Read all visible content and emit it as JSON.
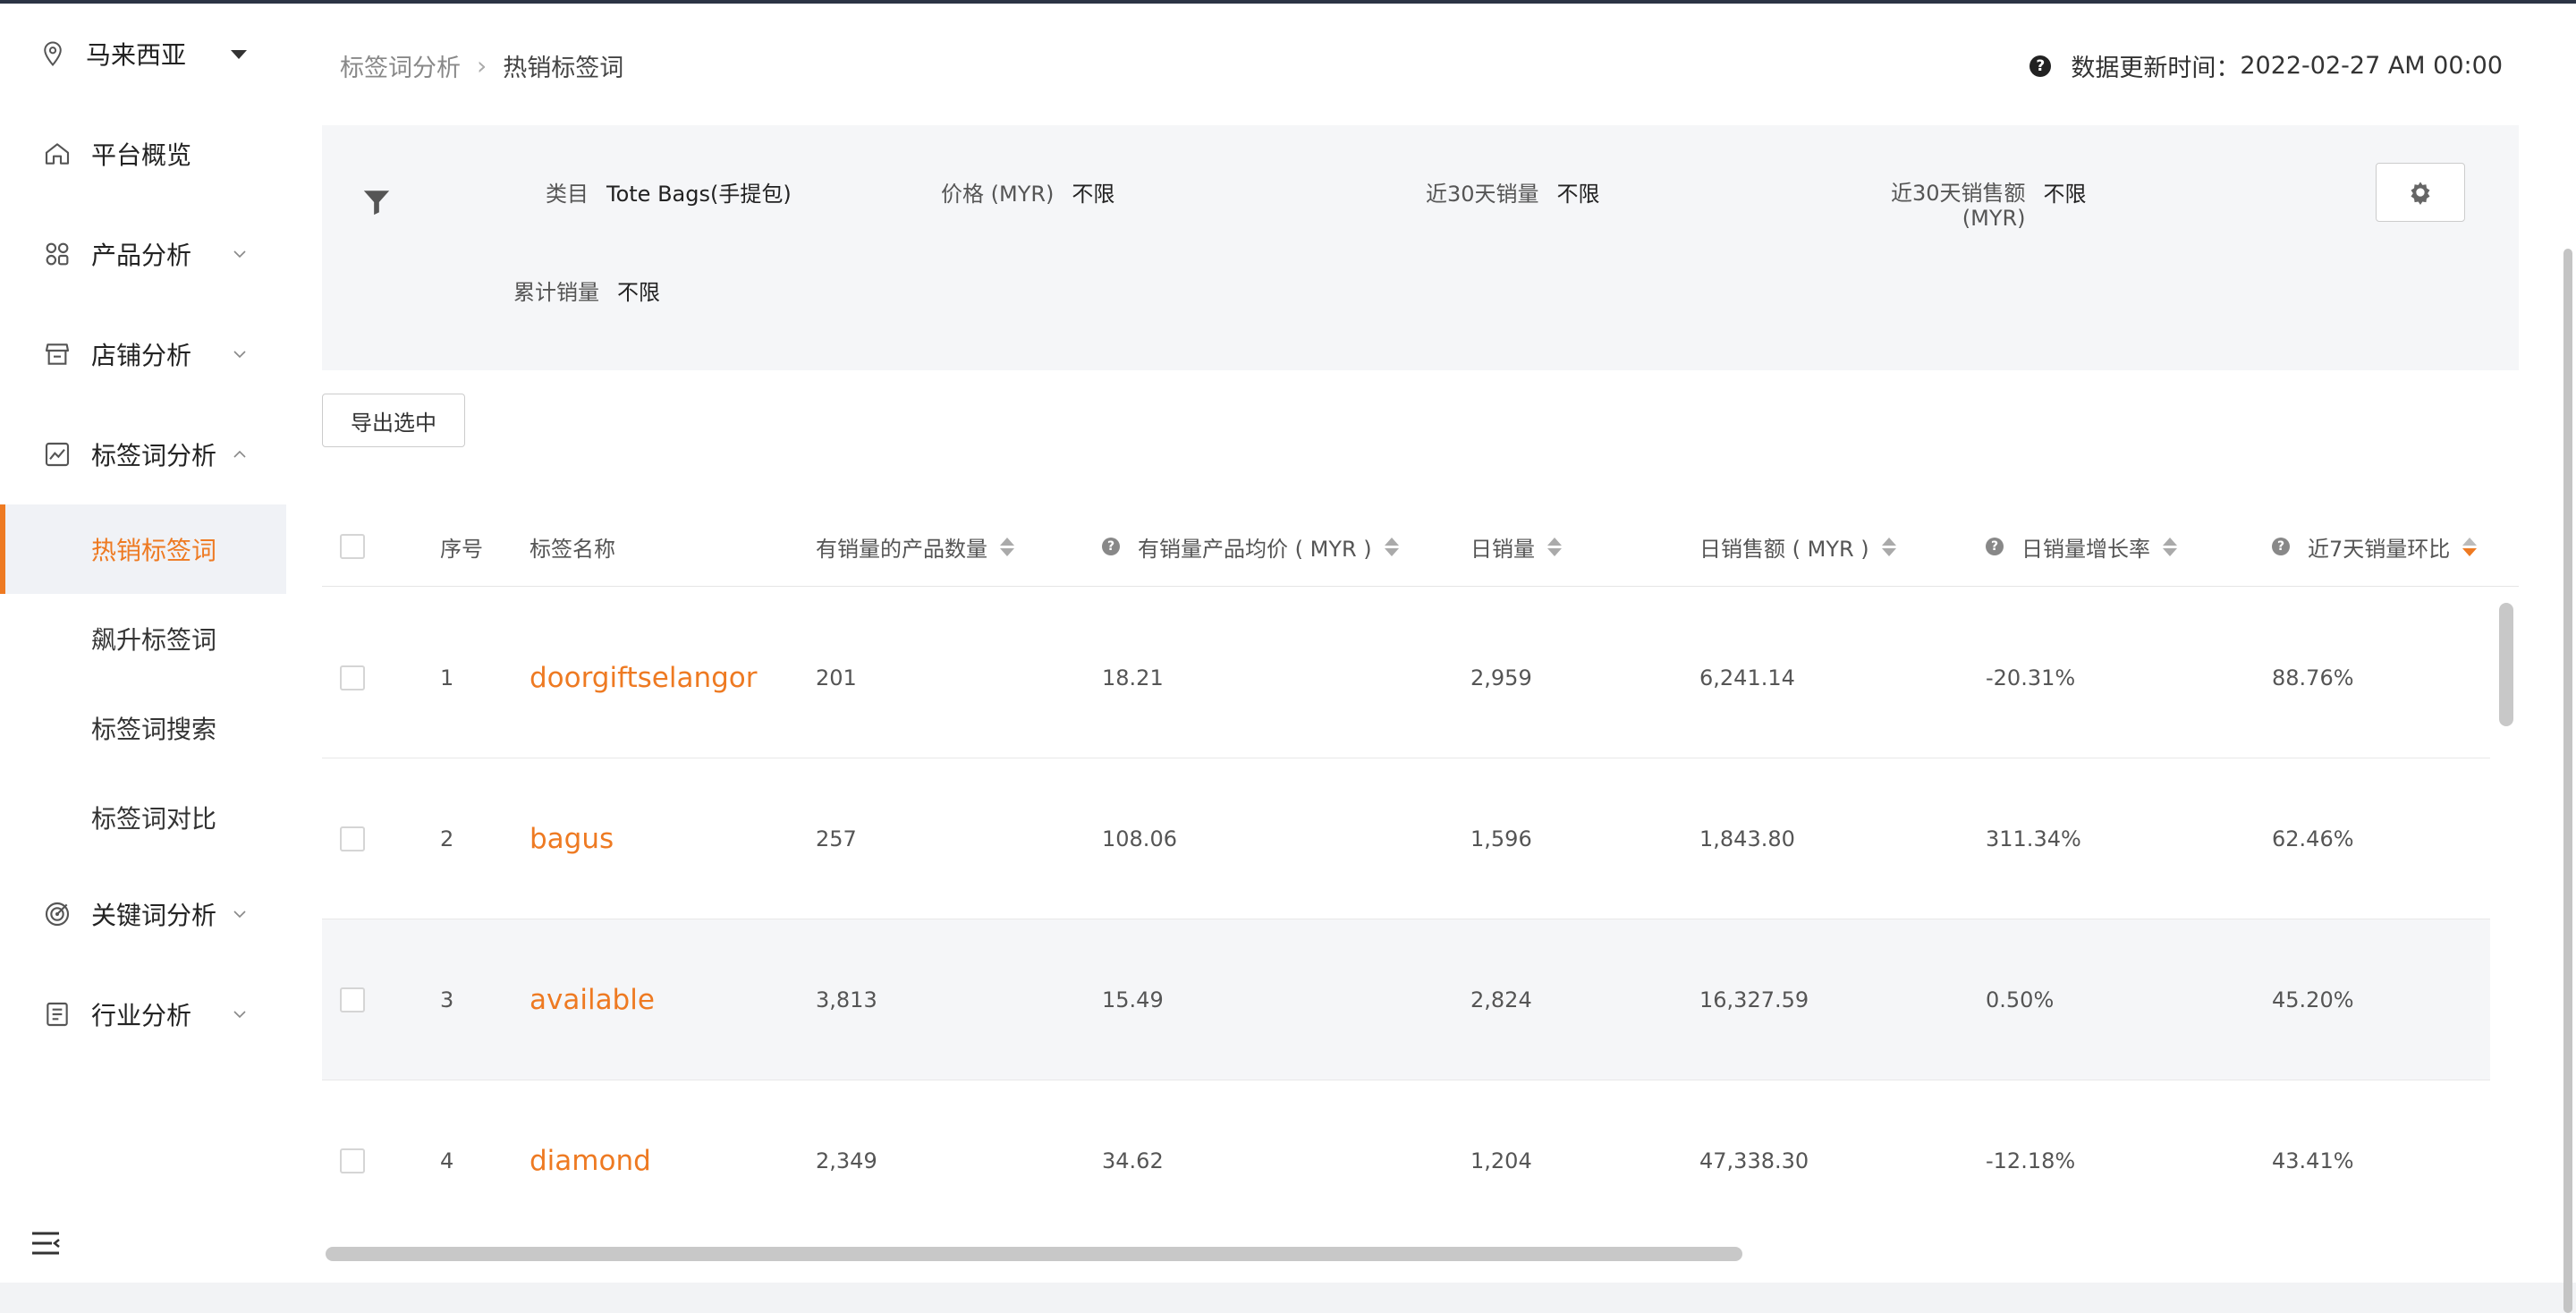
{
  "sidebar": {
    "region": "马来西亚",
    "items": [
      {
        "label": "平台概览",
        "icon": "home-icon",
        "expandable": false
      },
      {
        "label": "产品分析",
        "icon": "grid-icon",
        "expandable": true
      },
      {
        "label": "店铺分析",
        "icon": "store-icon",
        "expandable": true
      },
      {
        "label": "标签词分析",
        "icon": "chart-icon",
        "expandable": true,
        "expanded": true
      },
      {
        "label": "关键词分析",
        "icon": "target-icon",
        "expandable": true
      },
      {
        "label": "行业分析",
        "icon": "document-icon",
        "expandable": true
      }
    ],
    "sub_items": [
      {
        "label": "热销标签词",
        "active": true
      },
      {
        "label": "飙升标签词"
      },
      {
        "label": "标签词搜索"
      },
      {
        "label": "标签词对比"
      }
    ]
  },
  "header": {
    "breadcrumb": [
      "标签词分析",
      "热销标签词"
    ],
    "update_label": "数据更新时间：",
    "update_time": "2022-02-27 AM 00:00"
  },
  "filters": {
    "category_label": "类目",
    "category_value": "Tote Bags(手提包)",
    "price_label": "价格 (MYR)",
    "price_value": "不限",
    "sales30_label": "近30天销量",
    "sales30_value": "不限",
    "revenue30_label_1": "近30天销售额",
    "revenue30_label_2": "(MYR)",
    "revenue30_value": "不限",
    "total_label": "累计销量",
    "total_value": "不限"
  },
  "actions": {
    "export": "导出选中"
  },
  "table": {
    "columns": [
      "序号",
      "标签名称",
      "有销量的产品数量",
      "有销量产品均价 ( MYR )",
      "日销量",
      "日销售额 ( MYR )",
      "日销量增长率",
      "近7天销量环比"
    ],
    "rows": [
      {
        "index": "1",
        "name": "doorgiftselangor",
        "products": "201",
        "avg_price": "18.21",
        "daily_sales": "2,959",
        "daily_revenue": "6,241.14",
        "growth": "-20.31%",
        "wow": "88.76%"
      },
      {
        "index": "2",
        "name": "bagus",
        "products": "257",
        "avg_price": "108.06",
        "daily_sales": "1,596",
        "daily_revenue": "1,843.80",
        "growth": "311.34%",
        "wow": "62.46%"
      },
      {
        "index": "3",
        "name": "available",
        "products": "3,813",
        "avg_price": "15.49",
        "daily_sales": "2,824",
        "daily_revenue": "16,327.59",
        "growth": "0.50%",
        "wow": "45.20%"
      },
      {
        "index": "4",
        "name": "diamond",
        "products": "2,349",
        "avg_price": "34.62",
        "daily_sales": "1,204",
        "daily_revenue": "47,338.30",
        "growth": "-12.18%",
        "wow": "43.41%"
      }
    ]
  },
  "colors": {
    "accent": "#ee7a22",
    "sidebar_active_bg": "#f0f2f6",
    "filter_bg": "#f5f6f8"
  }
}
